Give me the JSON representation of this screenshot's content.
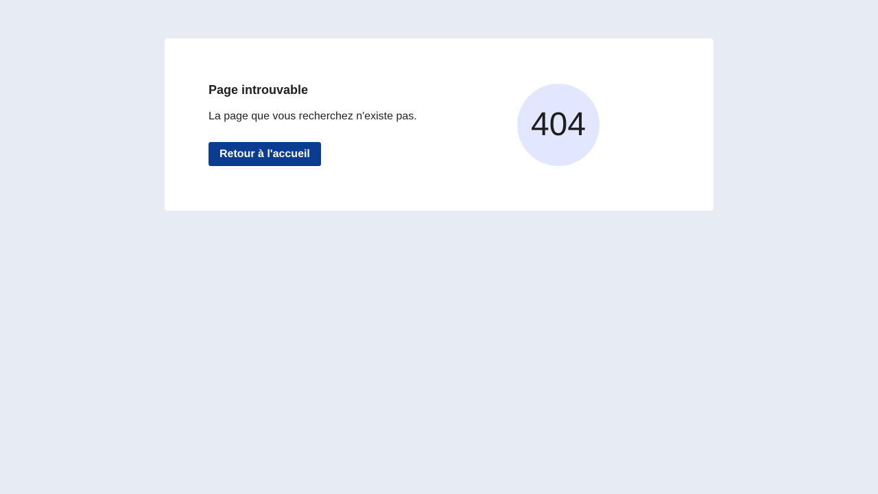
{
  "error_page": {
    "title": "Page introuvable",
    "message": "La page que vous recherchez n'existe pas.",
    "home_button_label": "Retour à l'accueil",
    "error_code": "404"
  },
  "colors": {
    "background": "#e7ebf4",
    "card": "#ffffff",
    "button": "#0a3d91",
    "badge": "#e2e6ff"
  }
}
